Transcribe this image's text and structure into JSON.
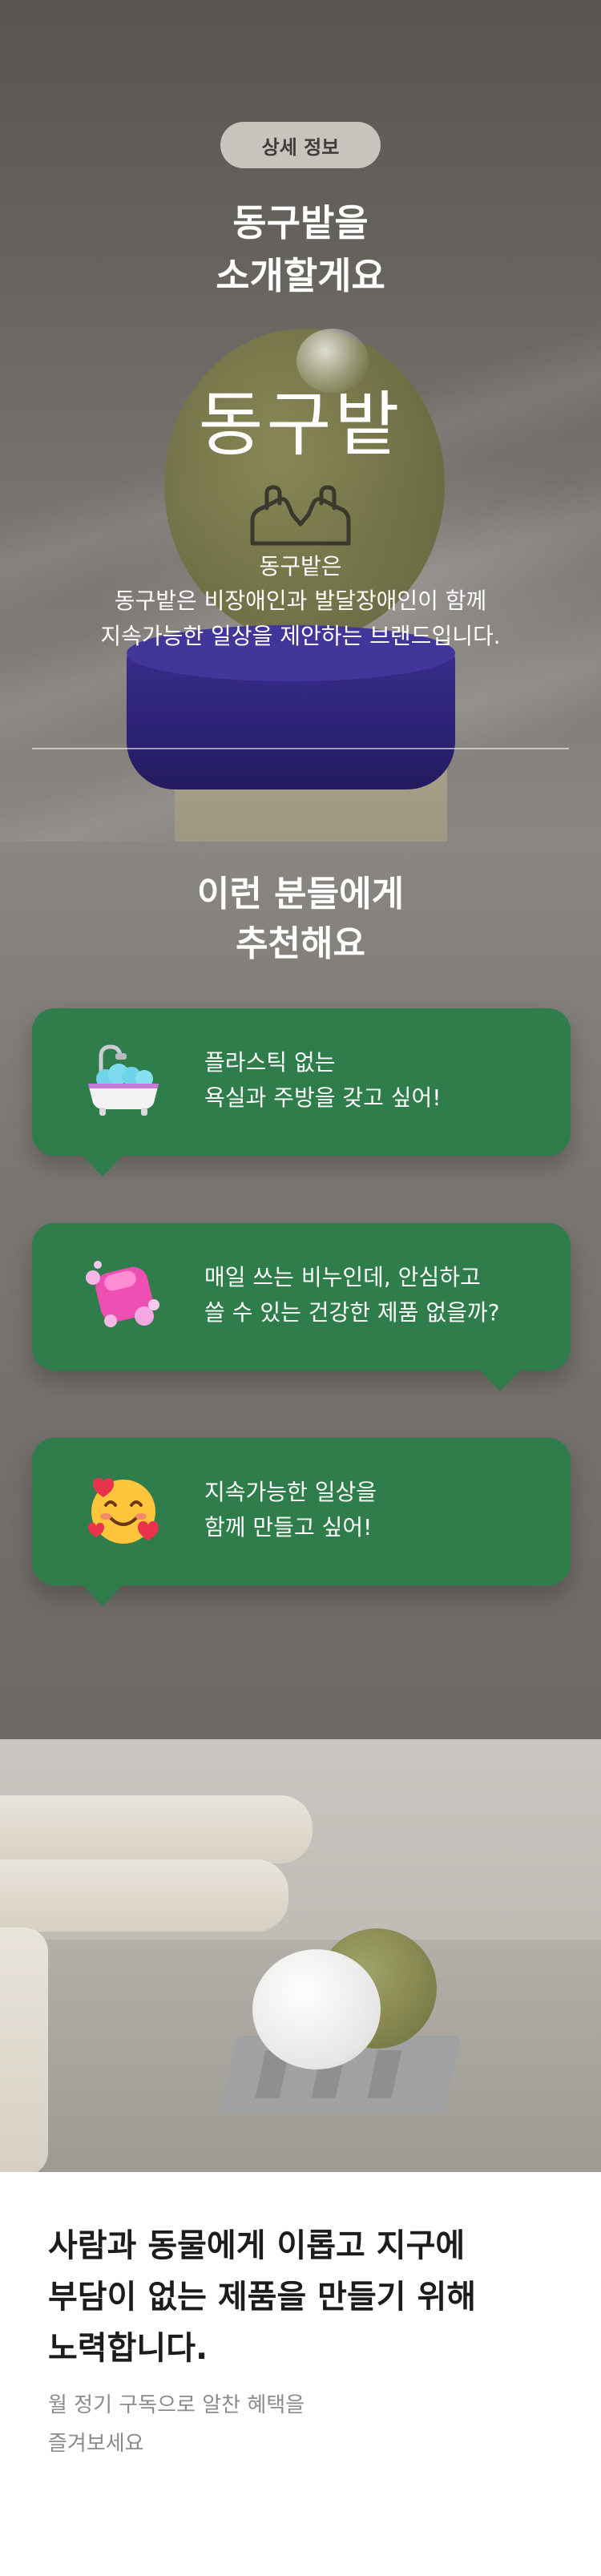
{
  "intro": {
    "badge": "상세 정보",
    "title_line1": "동구밭을",
    "title_line2": "소개할게요",
    "logo_text": "동구밭",
    "brand_name": "동구밭은",
    "desc_line1": "동구밭은 비장애인과 발달장애인이 함께",
    "desc_line2": "지속가능한 일상을 제안하는 브랜드입니다."
  },
  "recommend": {
    "title_line1": "이런 분들에게",
    "title_line2": "추천해요",
    "cards": [
      {
        "icon": "bathtub-icon",
        "line1": "플라스틱 없는",
        "line2": "욕실과 주방을 갖고 싶어!"
      },
      {
        "icon": "soap-bubbles-icon",
        "line1": "매일 쓰는 비누인데, 안심하고",
        "line2": "쓸 수 있는 건강한 제품 없을까?"
      },
      {
        "icon": "smiling-face-hearts-icon",
        "line1": "지속가능한 일상을",
        "line2": "함께 만들고 싶어!"
      }
    ]
  },
  "closing": {
    "title_line1": "사람과 동물에게 이롭고 지구에",
    "title_line2": "부담이 없는 제품을 만들기 위해",
    "title_line3": "노력합니다.",
    "sub_line1": "월 정기 구독으로 알찬 혜택을",
    "sub_line2": "즐겨보세요"
  },
  "colors": {
    "card_green": "#2f7d4a",
    "badge_bg": "#c7c3bd"
  }
}
